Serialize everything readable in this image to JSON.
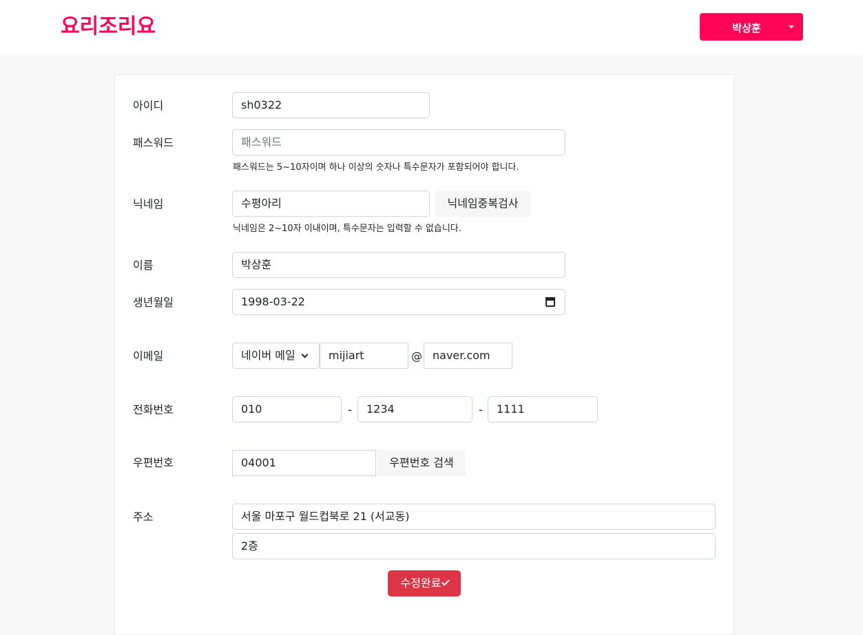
{
  "header": {
    "logo": "요리조리요",
    "user_name": "박상훈",
    "brand_color": "#ff0558"
  },
  "form": {
    "id": {
      "label": "아이디",
      "value": "sh0322"
    },
    "password": {
      "label": "패스워드",
      "placeholder": "패스워드",
      "help": "패스워드는 5~10자이며 하나 이상의 숫자나 특수문자가 포함되어야 합니다."
    },
    "nickname": {
      "label": "닉네임",
      "value": "수평아리",
      "check_button": "닉네임중복검사",
      "help": "닉네임은 2~10자 이내이며, 특수문자는 입력할 수 없습니다."
    },
    "name": {
      "label": "이름",
      "value": "박상훈"
    },
    "birthday": {
      "label": "생년월일",
      "value": "1998-03-22"
    },
    "email": {
      "label": "이메일",
      "provider_selected": "네이버 메일",
      "local_part": "mijiart",
      "at": "@",
      "domain": "naver.com"
    },
    "phone": {
      "label": "전화번호",
      "part1": "010",
      "part2": "1234",
      "part3": "1111",
      "dash": "-"
    },
    "postcode": {
      "label": "우편번호",
      "value": "04001",
      "search_button": "우편번호 검색"
    },
    "address": {
      "label": "주소",
      "line1": "서울 마포구 월드컵북로 21 (서교동)",
      "line2": "2층"
    },
    "submit": {
      "label": "수정완료",
      "color": "#dc3545"
    }
  }
}
